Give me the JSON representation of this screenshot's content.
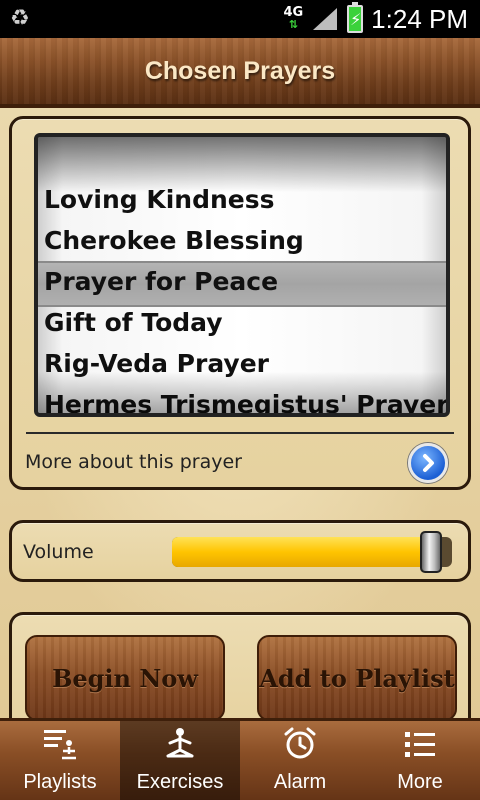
{
  "status_bar": {
    "network": "4G",
    "time": "1:24 PM"
  },
  "header": {
    "title": "Chosen Prayers"
  },
  "picker": {
    "items": [
      "Loving Kindness",
      "Cherokee Blessing",
      "Prayer for Peace",
      "Gift of Today",
      "Rig-Veda Prayer",
      "Hermes Trismegistus' Prayer"
    ],
    "selected_index": 2
  },
  "more_about": {
    "label": "More about this prayer"
  },
  "volume": {
    "label": "Volume",
    "level_percent": 96
  },
  "actions": {
    "begin": "Begin Now",
    "add_to_playlist": "Add to Playlist"
  },
  "tabs": [
    {
      "label": "Playlists",
      "icon": "playlist-meditation-icon"
    },
    {
      "label": "Exercises",
      "icon": "meditation-figure-icon",
      "active": true
    },
    {
      "label": "Alarm",
      "icon": "alarm-clock-icon"
    },
    {
      "label": "More",
      "icon": "list-icon"
    }
  ],
  "colors": {
    "volume_fill": "#ffc400",
    "wood": "#8b4e25",
    "info_button": "#1c5fd4"
  }
}
